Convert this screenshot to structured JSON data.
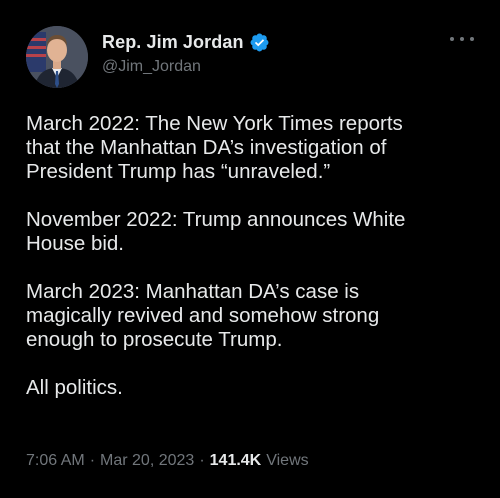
{
  "author": {
    "display_name": "Rep. Jim Jordan",
    "handle": "@Jim_Jordan",
    "verified_badge": "verified-check-icon",
    "badge_color": "#1d9bf0"
  },
  "more_menu": "more-options-icon",
  "tweet": {
    "text": "March 2022: The New York Times reports\nthat the Manhattan DA’s investigation of\nPresident Trump has “unraveled.”\n\nNovember 2022: Trump announces White\nHouse bid.\n\nMarch 2023: Manhattan DA’s case is\nmagically revived and somehow strong\nenough to prosecute Trump.\n\nAll politics."
  },
  "meta": {
    "time": "7:06 AM",
    "separator": "·",
    "date": "Mar 20, 2023",
    "views_count": "141.4K",
    "views_label": "Views"
  },
  "colors": {
    "background": "#000000",
    "text": "#e7e9ea",
    "secondary": "#71767b"
  }
}
